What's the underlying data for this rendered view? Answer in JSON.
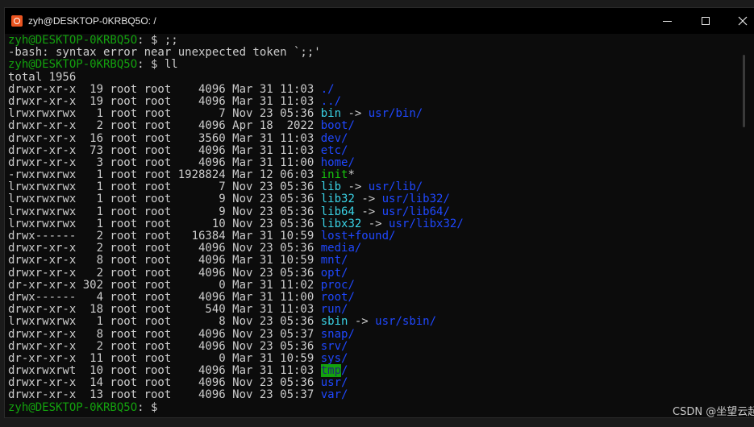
{
  "window": {
    "title": "zyh@DESKTOP-0KRBQ5O: /"
  },
  "terminal": {
    "lines": [
      [
        {
          "t": "zyh@DESKTOP-0KRBQ5O",
          "c": "prompt"
        },
        {
          "t": ": $ ;;"
        }
      ],
      [
        {
          "t": "-bash: syntax error near unexpected token `;;'"
        }
      ],
      [
        {
          "t": "zyh@DESKTOP-0KRBQ5O",
          "c": "prompt"
        },
        {
          "t": ": $ ll"
        }
      ],
      [
        {
          "t": "total 1956"
        }
      ],
      [
        {
          "t": "drwxr-xr-x  19 root root    4096 Mar 31 11:03 "
        },
        {
          "t": "./",
          "c": "c-blue"
        }
      ],
      [
        {
          "t": "drwxr-xr-x  19 root root    4096 Mar 31 11:03 "
        },
        {
          "t": "../",
          "c": "c-blue"
        }
      ],
      [
        {
          "t": "lrwxrwxrwx   1 root root       7 Nov 23 05:36 "
        },
        {
          "t": "bin",
          "c": "c-cyan"
        },
        {
          "t": " -> "
        },
        {
          "t": "usr/bin/",
          "c": "c-blue"
        }
      ],
      [
        {
          "t": "drwxr-xr-x   2 root root    4096 Apr 18  2022 "
        },
        {
          "t": "boot/",
          "c": "c-blue"
        }
      ],
      [
        {
          "t": "drwxr-xr-x  16 root root    3560 Mar 31 11:03 "
        },
        {
          "t": "dev/",
          "c": "c-blue"
        }
      ],
      [
        {
          "t": "drwxr-xr-x  73 root root    4096 Mar 31 11:03 "
        },
        {
          "t": "etc/",
          "c": "c-blue"
        }
      ],
      [
        {
          "t": "drwxr-xr-x   3 root root    4096 Mar 31 11:00 "
        },
        {
          "t": "home/",
          "c": "c-blue"
        }
      ],
      [
        {
          "t": "-rwxrwxrwx   1 root root 1928824 Mar 12 06:03 "
        },
        {
          "t": "init",
          "c": "c-green"
        },
        {
          "t": "*"
        }
      ],
      [
        {
          "t": "lrwxrwxrwx   1 root root       7 Nov 23 05:36 "
        },
        {
          "t": "lib",
          "c": "c-cyan"
        },
        {
          "t": " -> "
        },
        {
          "t": "usr/lib/",
          "c": "c-blue"
        }
      ],
      [
        {
          "t": "lrwxrwxrwx   1 root root       9 Nov 23 05:36 "
        },
        {
          "t": "lib32",
          "c": "c-cyan"
        },
        {
          "t": " -> "
        },
        {
          "t": "usr/lib32/",
          "c": "c-blue"
        }
      ],
      [
        {
          "t": "lrwxrwxrwx   1 root root       9 Nov 23 05:36 "
        },
        {
          "t": "lib64",
          "c": "c-cyan"
        },
        {
          "t": " -> "
        },
        {
          "t": "usr/lib64/",
          "c": "c-blue"
        }
      ],
      [
        {
          "t": "lrwxrwxrwx   1 root root      10 Nov 23 05:36 "
        },
        {
          "t": "libx32",
          "c": "c-cyan"
        },
        {
          "t": " -> "
        },
        {
          "t": "usr/libx32/",
          "c": "c-blue"
        }
      ],
      [
        {
          "t": "drwx------   2 root root   16384 Mar 31 10:59 "
        },
        {
          "t": "lost+found/",
          "c": "c-blue"
        }
      ],
      [
        {
          "t": "drwxr-xr-x   2 root root    4096 Nov 23 05:36 "
        },
        {
          "t": "media/",
          "c": "c-blue"
        }
      ],
      [
        {
          "t": "drwxr-xr-x   8 root root    4096 Mar 31 10:59 "
        },
        {
          "t": "mnt/",
          "c": "c-blue"
        }
      ],
      [
        {
          "t": "drwxr-xr-x   2 root root    4096 Nov 23 05:36 "
        },
        {
          "t": "opt/",
          "c": "c-blue"
        }
      ],
      [
        {
          "t": "dr-xr-xr-x 302 root root       0 Mar 31 11:02 "
        },
        {
          "t": "proc/",
          "c": "c-blue"
        }
      ],
      [
        {
          "t": "drwx------   4 root root    4096 Mar 31 11:00 "
        },
        {
          "t": "root/",
          "c": "c-blue"
        }
      ],
      [
        {
          "t": "drwxr-xr-x  18 root root     540 Mar 31 11:03 "
        },
        {
          "t": "run/",
          "c": "c-blue"
        }
      ],
      [
        {
          "t": "lrwxrwxrwx   1 root root       8 Nov 23 05:36 "
        },
        {
          "t": "sbin",
          "c": "c-cyan"
        },
        {
          "t": " -> "
        },
        {
          "t": "usr/sbin/",
          "c": "c-blue"
        }
      ],
      [
        {
          "t": "drwxr-xr-x   8 root root    4096 Nov 23 05:37 "
        },
        {
          "t": "snap/",
          "c": "c-blue"
        }
      ],
      [
        {
          "t": "drwxr-xr-x   2 root root    4096 Nov 23 05:36 "
        },
        {
          "t": "srv/",
          "c": "c-blue"
        }
      ],
      [
        {
          "t": "dr-xr-xr-x  11 root root       0 Mar 31 10:59 "
        },
        {
          "t": "sys/",
          "c": "c-blue"
        }
      ],
      [
        {
          "t": "drwxrwxrwt  10 root root    4096 Mar 31 11:03 "
        },
        {
          "t": "tmp",
          "c": "c-tmp"
        },
        {
          "t": "/",
          "c": "c-blue"
        }
      ],
      [
        {
          "t": "drwxr-xr-x  14 root root    4096 Nov 23 05:36 "
        },
        {
          "t": "usr/",
          "c": "c-blue"
        }
      ],
      [
        {
          "t": "drwxr-xr-x  13 root root    4096 Nov 23 05:37 "
        },
        {
          "t": "var/",
          "c": "c-blue"
        }
      ],
      [
        {
          "t": "zyh@DESKTOP-0KRBQ5O",
          "c": "prompt"
        },
        {
          "t": ": $"
        }
      ]
    ]
  },
  "watermark": "CSDN @坐望云起"
}
